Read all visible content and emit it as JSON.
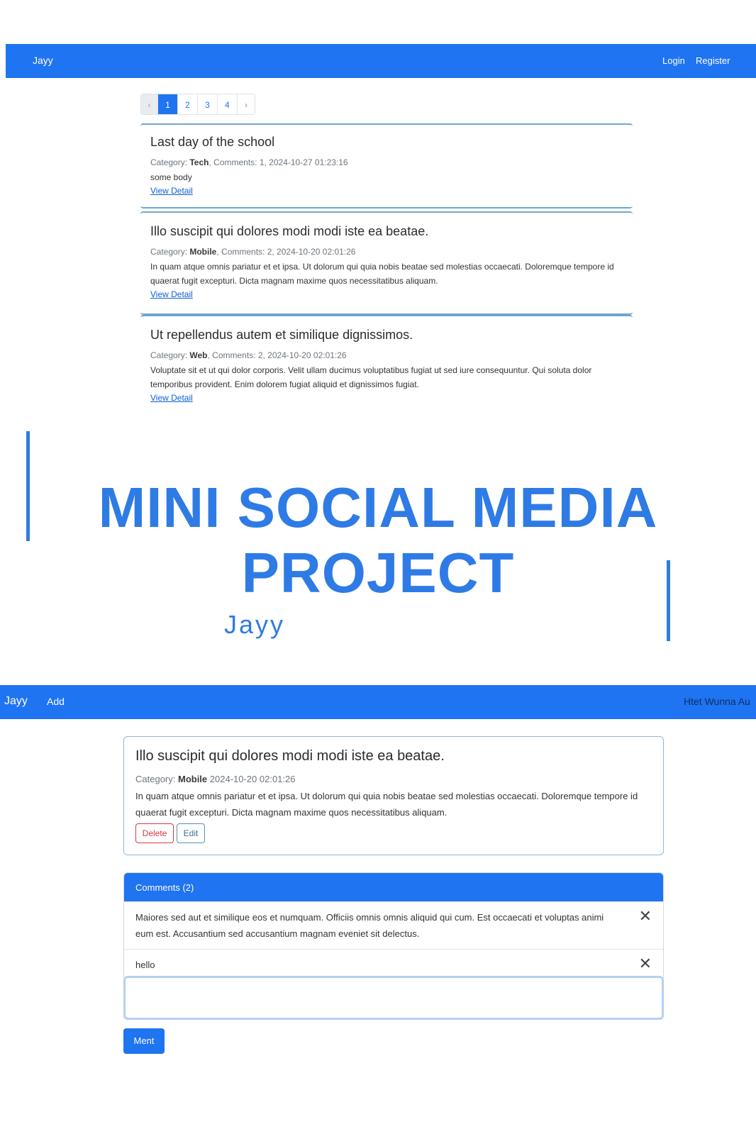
{
  "top_screenshot": {
    "navbar": {
      "brand": "Jayy",
      "login": "Login",
      "register": "Register"
    },
    "pagination": {
      "prev": "‹",
      "pages": [
        "1",
        "2",
        "3",
        "4"
      ],
      "next": "›",
      "active": "1"
    },
    "posts": [
      {
        "title": "Last day of the school",
        "category_label": "Category: ",
        "category": "Tech",
        "comments_text": ", Comments: 1, 2024-10-27 01:23:16",
        "body": "some body",
        "link": "View Detail"
      },
      {
        "title": "Illo suscipit qui dolores modi modi iste ea beatae.",
        "category_label": "Category: ",
        "category": "Mobile",
        "comments_text": ", Comments: 2, 2024-10-20 02:01:26",
        "body": "In quam atque omnis pariatur et et ipsa. Ut dolorum qui quia nobis beatae sed molestias occaecati. Doloremque tempore id quaerat fugit excepturi. Dicta magnam maxime quos necessitatibus aliquam.",
        "link": "View Detail"
      },
      {
        "title": "Ut repellendus autem et similique dignissimos.",
        "category_label": "Category: ",
        "category": "Web",
        "comments_text": ", Comments: 2, 2024-10-20 02:01:26",
        "body": "Voluptate sit et ut qui dolor corporis. Velit ullam ducimus voluptatibus fugiat ut sed iure consequuntur. Qui soluta dolor temporibus provident. Enim dolorem fugiat aliquid et dignissimos fugiat.",
        "link": "View Detail"
      }
    ]
  },
  "headline": {
    "title_line1": "MINI SOCIAL MEDIA",
    "title_line2": "PROJECT",
    "author": "Jayy",
    "accent_color": "#2f7be6"
  },
  "bottom_screenshot": {
    "navbar": {
      "brand": "Jayy",
      "add": "Add",
      "user": "Htet Wunna Au"
    },
    "post": {
      "title": "Illo suscipit qui dolores modi modi iste ea beatae.",
      "category_label": "Category: ",
      "category": "Mobile",
      "date": " 2024-10-20 02:01:26",
      "body": "In quam atque omnis pariatur et et ipsa. Ut dolorum qui quia nobis beatae sed molestias occaecati. Doloremque tempore id quaerat fugit excepturi. Dicta magnam maxime quos necessitatibus aliquam.",
      "delete_label": "Delete",
      "edit_label": "Edit"
    },
    "comments": {
      "header": "Comments (2)",
      "items": [
        {
          "text": "Maiores sed aut et similique eos et numquam. Officiis omnis omnis aliquid qui cum. Est occaecati et voluptas animi eum est. Accusantium sed accusantium magnam eveniet sit delectus.",
          "close_icon": "close-icon"
        },
        {
          "text": "hello",
          "close_icon": "close-icon"
        }
      ]
    },
    "comment_input": {
      "value": ""
    },
    "submit_label": "Ment"
  },
  "colors": {
    "primary": "#1f74f2",
    "danger": "#dc3545"
  }
}
